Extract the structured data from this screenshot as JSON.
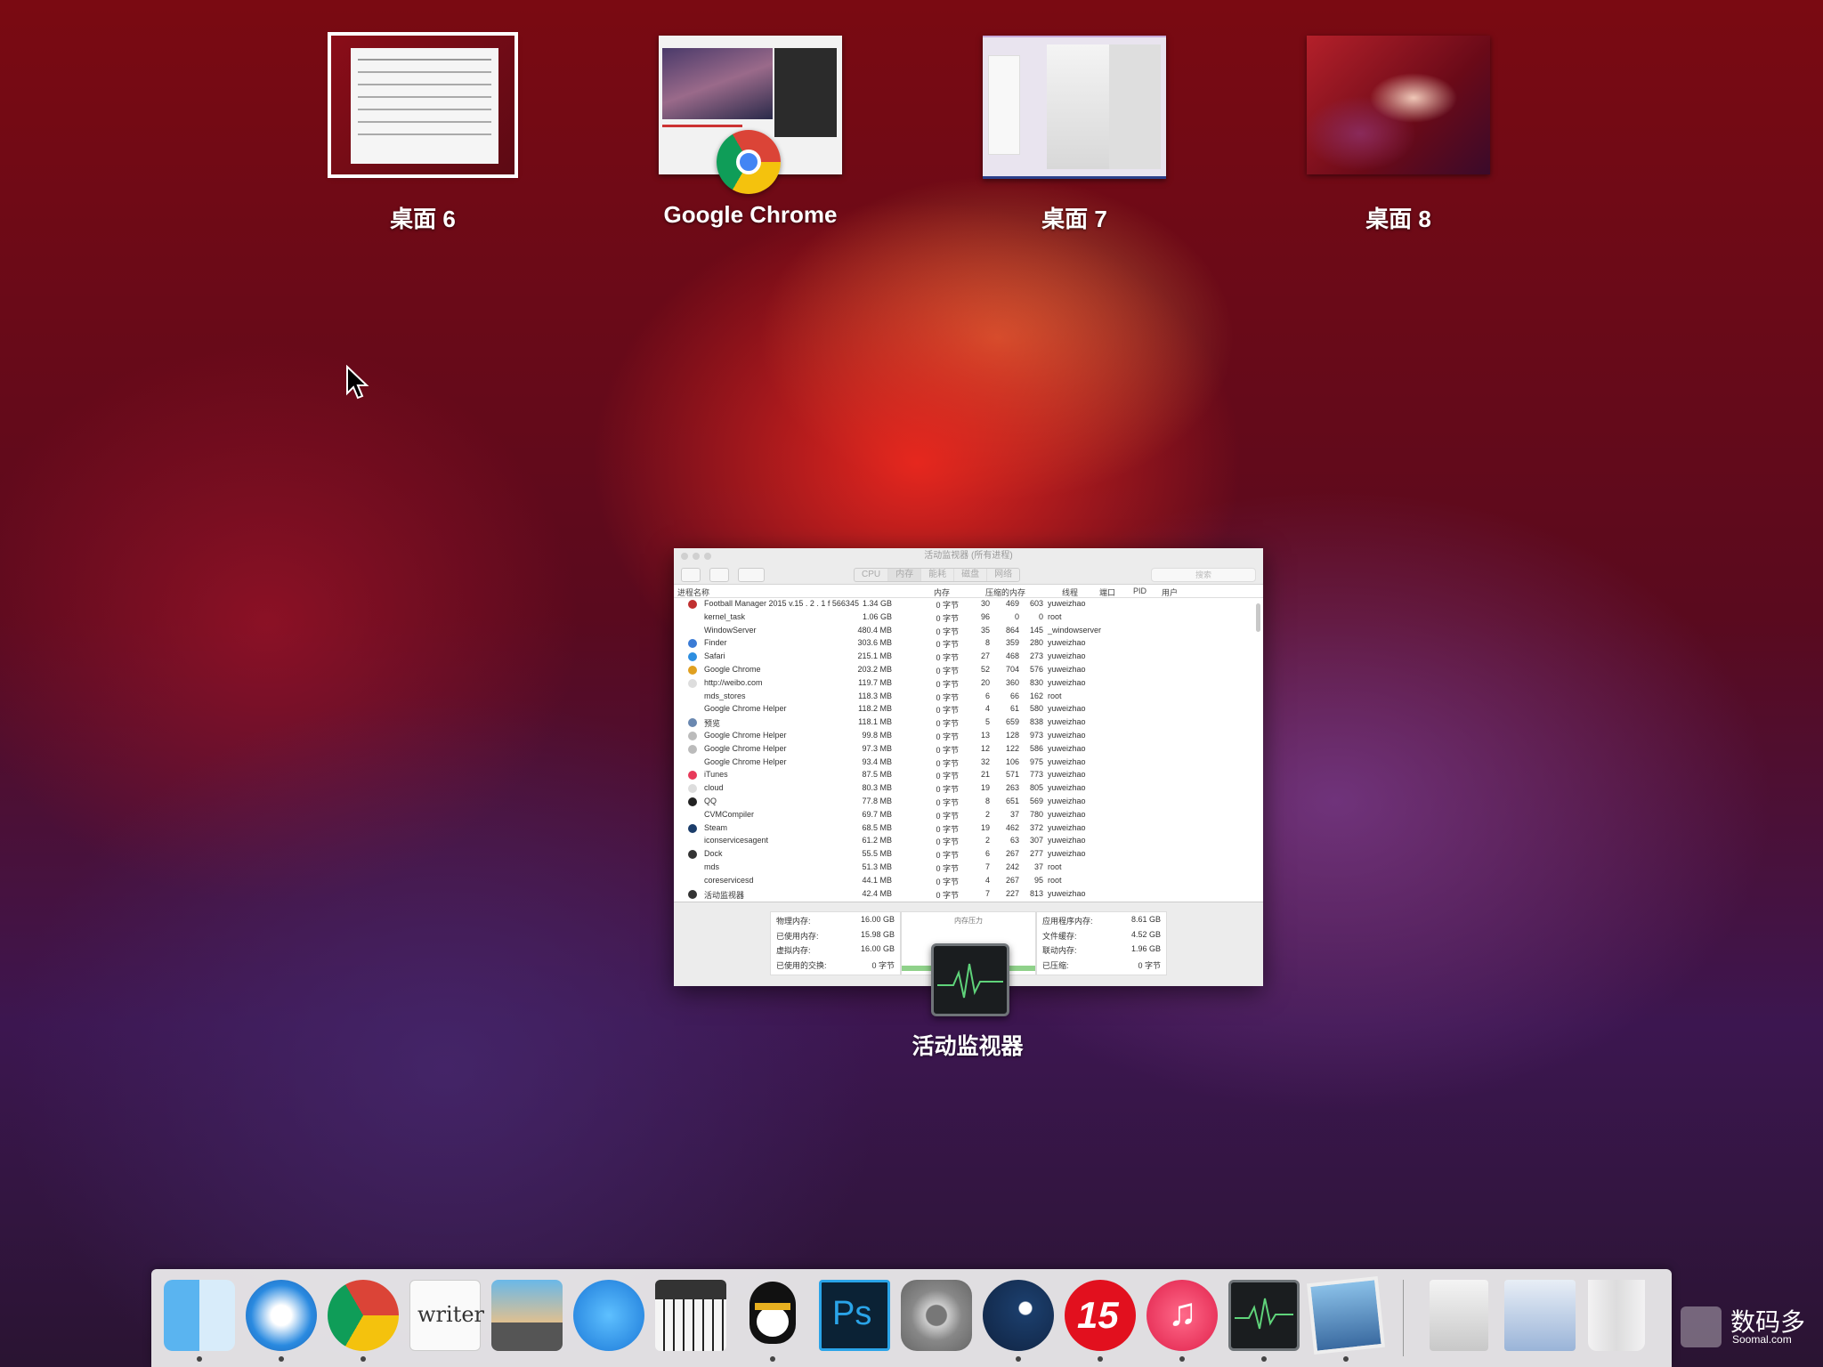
{
  "mission_control": {
    "desktops": [
      {
        "label": "桌面 6"
      },
      {
        "label": "Google Chrome"
      },
      {
        "label": "桌面 7"
      },
      {
        "label": "桌面 8"
      }
    ],
    "window_label": "活动监视器"
  },
  "activity_monitor": {
    "title": "活动监视器 (所有进程)",
    "tabs": [
      "CPU",
      "内存",
      "能耗",
      "磁盘",
      "网络"
    ],
    "active_tab": "内存",
    "search_placeholder": "搜索",
    "columns": {
      "name": "进程名称",
      "memory": "内存",
      "compressed": "压缩的内存",
      "threads": "线程",
      "ports": "端口",
      "pid": "PID",
      "user": "用户"
    },
    "processes": [
      {
        "name": "Football Manager 2015 v.15 . 2 . 1 f 566345",
        "mem": "1.34 GB",
        "comp": "0 字节",
        "th": "30",
        "port": "469",
        "pid": "603",
        "user": "yuweizhao",
        "icon": "#c03030"
      },
      {
        "name": "kernel_task",
        "mem": "1.06 GB",
        "comp": "0 字节",
        "th": "96",
        "port": "0",
        "pid": "0",
        "user": "root",
        "icon": ""
      },
      {
        "name": "WindowServer",
        "mem": "480.4 MB",
        "comp": "0 字节",
        "th": "35",
        "port": "864",
        "pid": "145",
        "user": "_windowserver",
        "icon": ""
      },
      {
        "name": "Finder",
        "mem": "303.6 MB",
        "comp": "0 字节",
        "th": "8",
        "port": "359",
        "pid": "280",
        "user": "yuweizhao",
        "icon": "#3a7bd5"
      },
      {
        "name": "Safari",
        "mem": "215.1 MB",
        "comp": "0 字节",
        "th": "27",
        "port": "468",
        "pid": "273",
        "user": "yuweizhao",
        "icon": "#2d8ee0"
      },
      {
        "name": "Google Chrome",
        "mem": "203.2 MB",
        "comp": "0 字节",
        "th": "52",
        "port": "704",
        "pid": "576",
        "user": "yuweizhao",
        "icon": "#e0a020"
      },
      {
        "name": "http://weibo.com",
        "mem": "119.7 MB",
        "comp": "0 字节",
        "th": "20",
        "port": "360",
        "pid": "830",
        "user": "yuweizhao",
        "icon": "#dddddd"
      },
      {
        "name": "mds_stores",
        "mem": "118.3 MB",
        "comp": "0 字节",
        "th": "6",
        "port": "66",
        "pid": "162",
        "user": "root",
        "icon": ""
      },
      {
        "name": "Google Chrome Helper",
        "mem": "118.2 MB",
        "comp": "0 字节",
        "th": "4",
        "port": "61",
        "pid": "580",
        "user": "yuweizhao",
        "icon": ""
      },
      {
        "name": "预览",
        "mem": "118.1 MB",
        "comp": "0 字节",
        "th": "5",
        "port": "659",
        "pid": "838",
        "user": "yuweizhao",
        "icon": "#6a88b0"
      },
      {
        "name": "Google Chrome Helper",
        "mem": "99.8 MB",
        "comp": "0 字节",
        "th": "13",
        "port": "128",
        "pid": "973",
        "user": "yuweizhao",
        "icon": "#bbbbbb"
      },
      {
        "name": "Google Chrome Helper",
        "mem": "97.3 MB",
        "comp": "0 字节",
        "th": "12",
        "port": "122",
        "pid": "586",
        "user": "yuweizhao",
        "icon": "#bbbbbb"
      },
      {
        "name": "Google Chrome Helper",
        "mem": "93.4 MB",
        "comp": "0 字节",
        "th": "32",
        "port": "106",
        "pid": "975",
        "user": "yuweizhao",
        "icon": ""
      },
      {
        "name": "iTunes",
        "mem": "87.5 MB",
        "comp": "0 字节",
        "th": "21",
        "port": "571",
        "pid": "773",
        "user": "yuweizhao",
        "icon": "#e83a5a"
      },
      {
        "name": "cloud",
        "mem": "80.3 MB",
        "comp": "0 字节",
        "th": "19",
        "port": "263",
        "pid": "805",
        "user": "yuweizhao",
        "icon": "#dddddd"
      },
      {
        "name": "QQ",
        "mem": "77.8 MB",
        "comp": "0 字节",
        "th": "8",
        "port": "651",
        "pid": "569",
        "user": "yuweizhao",
        "icon": "#222222"
      },
      {
        "name": "CVMCompiler",
        "mem": "69.7 MB",
        "comp": "0 字节",
        "th": "2",
        "port": "37",
        "pid": "780",
        "user": "yuweizhao",
        "icon": ""
      },
      {
        "name": "Steam",
        "mem": "68.5 MB",
        "comp": "0 字节",
        "th": "19",
        "port": "462",
        "pid": "372",
        "user": "yuweizhao",
        "icon": "#1b3d6a"
      },
      {
        "name": "iconservicesagent",
        "mem": "61.2 MB",
        "comp": "0 字节",
        "th": "2",
        "port": "63",
        "pid": "307",
        "user": "yuweizhao",
        "icon": ""
      },
      {
        "name": "Dock",
        "mem": "55.5 MB",
        "comp": "0 字节",
        "th": "6",
        "port": "267",
        "pid": "277",
        "user": "yuweizhao",
        "icon": "#333333"
      },
      {
        "name": "mds",
        "mem": "51.3 MB",
        "comp": "0 字节",
        "th": "7",
        "port": "242",
        "pid": "37",
        "user": "root",
        "icon": ""
      },
      {
        "name": "coreservicesd",
        "mem": "44.1 MB",
        "comp": "0 字节",
        "th": "4",
        "port": "267",
        "pid": "95",
        "user": "root",
        "icon": ""
      },
      {
        "name": "活动监视器",
        "mem": "42.4 MB",
        "comp": "0 字节",
        "th": "7",
        "port": "227",
        "pid": "813",
        "user": "yuweizhao",
        "icon": "#333333"
      }
    ],
    "footer": {
      "left": [
        {
          "k": "物理内存:",
          "v": "16.00 GB"
        },
        {
          "k": "已使用内存:",
          "v": "15.98 GB"
        },
        {
          "k": "虚拟内存:",
          "v": "16.00 GB"
        },
        {
          "k": "已使用的交换:",
          "v": "0 字节"
        }
      ],
      "pressure_label": "内存压力",
      "right": [
        {
          "k": "应用程序内存:",
          "v": "8.61 GB"
        },
        {
          "k": "文件缓存:",
          "v": "4.52 GB"
        },
        {
          "k": "联动内存:",
          "v": "1.96 GB"
        },
        {
          "k": "已压缩:",
          "v": "0 字节"
        }
      ]
    }
  },
  "dock": {
    "items": [
      {
        "icon": "finder-icon",
        "running": true
      },
      {
        "icon": "safari-icon",
        "running": true
      },
      {
        "icon": "chrome-icon",
        "running": true
      },
      {
        "icon": "writer-icon",
        "label": "writer",
        "running": false
      },
      {
        "icon": "image-capture-icon",
        "running": false
      },
      {
        "icon": "app-store-icon",
        "running": false
      },
      {
        "icon": "piano-icon",
        "running": false
      },
      {
        "icon": "qq-icon",
        "running": true
      },
      {
        "icon": "photoshop-icon",
        "label": "Ps",
        "running": false
      },
      {
        "icon": "system-preferences-icon",
        "running": false
      },
      {
        "icon": "steam-icon",
        "running": true
      },
      {
        "icon": "football-manager-icon",
        "label": "15",
        "running": true
      },
      {
        "icon": "itunes-icon",
        "running": true
      },
      {
        "icon": "activity-monitor-icon",
        "running": true
      },
      {
        "icon": "preview-icon",
        "running": true
      }
    ],
    "right_items": [
      {
        "icon": "documents-stack-icon"
      },
      {
        "icon": "downloads-stack-icon"
      },
      {
        "icon": "trash-icon"
      }
    ]
  },
  "watermark": {
    "text": "数码多",
    "sub": "Soomal.com"
  },
  "colors": {
    "dock_bg": "#f0f0f0",
    "window_bg": "#ffffff",
    "thumb_selected_border": "#ffffff"
  }
}
